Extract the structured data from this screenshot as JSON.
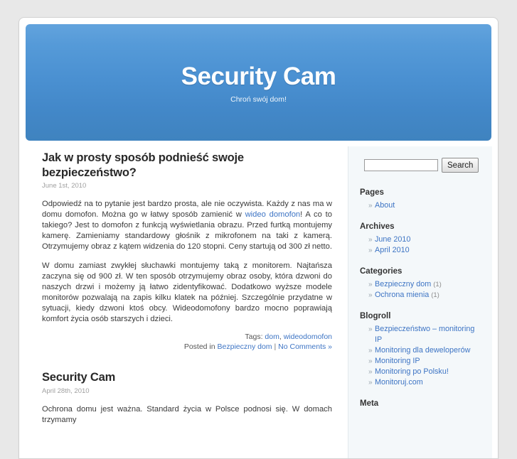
{
  "site": {
    "title": "Security Cam",
    "description": "Chroń swój dom!"
  },
  "search": {
    "value": "",
    "placeholder": "",
    "button_label": "Search"
  },
  "posts": [
    {
      "title": "Jak w prosty sposób podnieść swoje bezpieczeństwo?",
      "date": "June 1st, 2010",
      "paragraphs": [
        {
          "pre": "Odpowiedź na to pytanie jest bardzo prosta, ale nie oczywista. Każdy z nas ma w domu domofon. Można go w łatwy sposób zamienić w ",
          "link": "wideo domofon",
          "post": "! A co to takiego? Jest to domofon z funkcją wyświetlania obrazu. Przed furtką montujemy kamerę. Zamieniamy standardowy głośnik z mikrofonem na taki z kamerą. Otrzymujemy obraz z kątem widzenia do 120 stopni. Ceny startują od 300 zł netto."
        },
        {
          "pre": "W domu zamiast zwykłej słuchawki montujemy taką z monitorem. Najtańsza zaczyna się od 900 zł. W ten sposób otrzymujemy obraz osoby, która dzwoni do naszych drzwi i możemy ją łatwo zidentyfikować. Dodatkowo wyższe modele monitorów pozwalają na zapis kilku klatek na później. Szczególnie przydatne w sytuacji, kiedy dzwoni ktoś obcy. Wideodomofony bardzo mocno poprawiają komfort życia osób starszych i dzieci.",
          "link": "",
          "post": ""
        }
      ],
      "meta": {
        "tags_label": "Tags:",
        "tags": [
          "dom",
          "wideodomofon"
        ],
        "posted_in_label": "Posted in",
        "category": "Bezpieczny dom",
        "separator": "|",
        "comments": "No Comments »"
      }
    },
    {
      "title": "Security Cam",
      "date": "April 28th, 2010",
      "paragraphs": [
        {
          "pre": "Ochrona domu jest ważna. Standard życia w Polsce podnosi się. W domach trzymamy",
          "link": "",
          "post": ""
        }
      ],
      "meta": null
    }
  ],
  "sidebar": {
    "widgets": [
      {
        "title": "Pages",
        "items": [
          {
            "label": "About",
            "count": ""
          }
        ]
      },
      {
        "title": "Archives",
        "items": [
          {
            "label": "June 2010",
            "count": ""
          },
          {
            "label": "April 2010",
            "count": ""
          }
        ]
      },
      {
        "title": "Categories",
        "items": [
          {
            "label": "Bezpieczny dom",
            "count": "(1)"
          },
          {
            "label": "Ochrona mienia",
            "count": "(1)"
          }
        ]
      },
      {
        "title": "Blogroll",
        "items": [
          {
            "label": "Bezpieczeństwo – monitoring IP",
            "count": ""
          },
          {
            "label": "Monitoring dla deweloperów",
            "count": ""
          },
          {
            "label": "Monitoring IP",
            "count": ""
          },
          {
            "label": "Monitoring po Polsku!",
            "count": ""
          },
          {
            "label": "Monitoruj.com",
            "count": ""
          }
        ]
      },
      {
        "title": "Meta",
        "items": []
      }
    ],
    "bullet": "»"
  },
  "colors": {
    "page_background": "#e8e8e8",
    "header_gradient_top": "#62a3dd",
    "header_gradient_bottom": "#3f83bf",
    "link": "#3d74c4",
    "sidebar_background": "#f4f8fa",
    "text": "#3a3a3a"
  }
}
